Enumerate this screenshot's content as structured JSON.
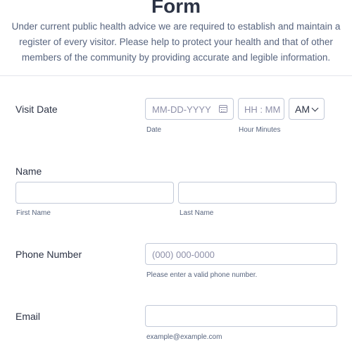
{
  "header": {
    "title": "Form",
    "description": "Under current public health advice we are required to establish and maintain a register of every visitor. Please help to protect your health and that of other members of the community by providing accurate and legible information."
  },
  "visit_date": {
    "label": "Visit Date",
    "date_placeholder": "MM-DD-YYYY",
    "date_sublabel": "Date",
    "time_placeholder": "HH : MM",
    "time_sublabel": "Hour Minutes",
    "ampm_value": "AM",
    "icon": "calendar-icon"
  },
  "name": {
    "label": "Name",
    "first_sublabel": "First Name",
    "last_sublabel": "Last Name"
  },
  "phone": {
    "label": "Phone Number",
    "placeholder": "(000) 000-0000",
    "sublabel": "Please enter a valid phone number."
  },
  "email": {
    "label": "Email",
    "sublabel": "example@example.com"
  }
}
